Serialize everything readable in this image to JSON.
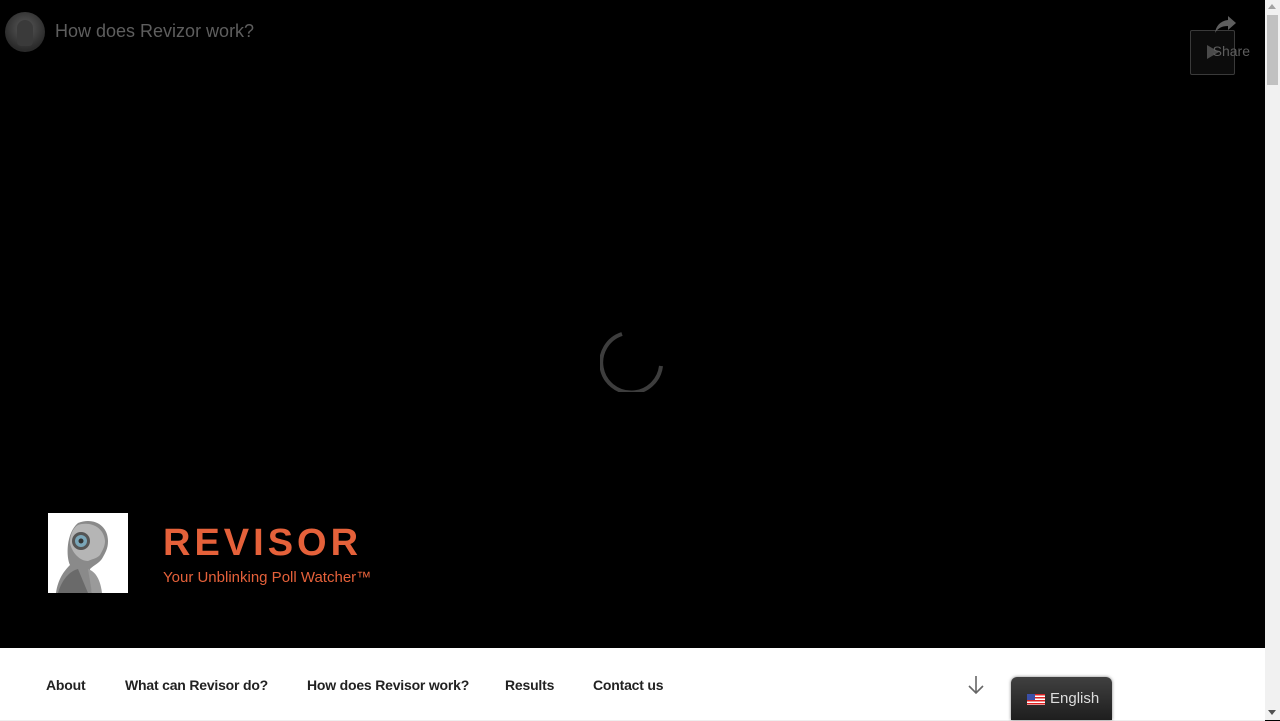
{
  "video": {
    "title": "How does Revizor work?",
    "share_label": "Share",
    "status": "loading"
  },
  "site": {
    "title": "REVISOR",
    "tagline": "Your Unblinking Poll Watcher™",
    "accent_color": "#e5613a"
  },
  "nav": {
    "items": [
      {
        "label": "About"
      },
      {
        "label": "What can Revisor do?"
      },
      {
        "label": "How does Revisor work?"
      },
      {
        "label": "Results"
      },
      {
        "label": "Contact us"
      }
    ],
    "scroll_down_icon": "arrow-down-icon"
  },
  "language": {
    "selected": "English",
    "flag_icon": "us-flag-icon"
  }
}
